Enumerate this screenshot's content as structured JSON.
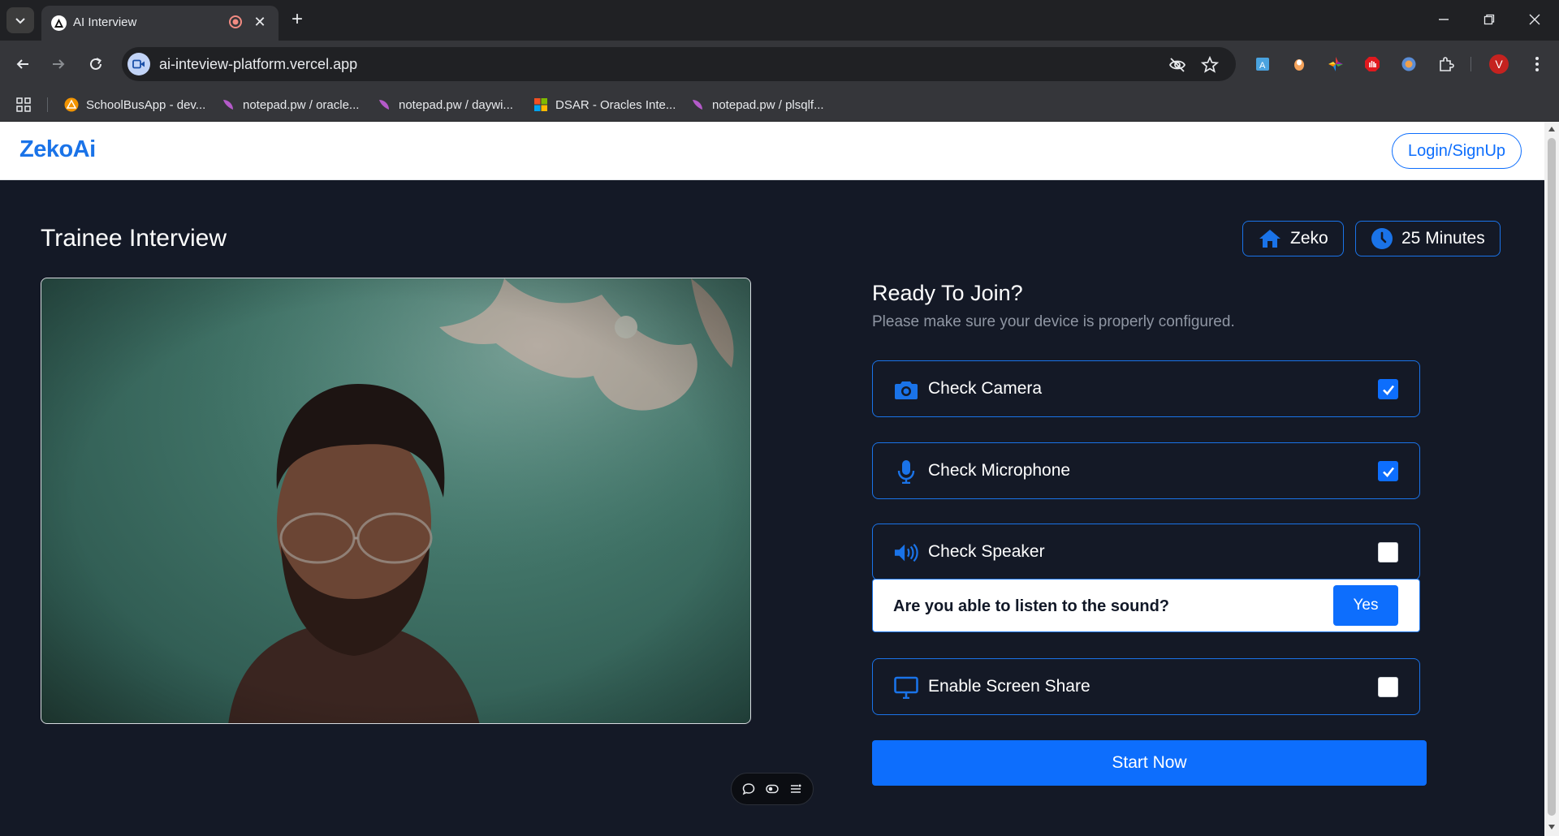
{
  "browser": {
    "tab_title": "AI Interview",
    "url": "ai-inteview-platform.vercel.app",
    "profile_initial": "V",
    "bookmarks": [
      {
        "label": "SchoolBusApp - dev..."
      },
      {
        "label": "notepad.pw / oracle..."
      },
      {
        "label": "notepad.pw / daywi..."
      },
      {
        "label": "DSAR - Oracles Inte..."
      },
      {
        "label": "notepad.pw / plsqlf..."
      }
    ]
  },
  "nav": {
    "brand": "ZekoAi",
    "login_label": "Login/SignUp"
  },
  "header": {
    "title": "Trainee Interview",
    "company_label": "Zeko",
    "duration_label": "25 Minutes"
  },
  "setup": {
    "title": "Ready To Join?",
    "subtitle": "Please make sure your device is properly configured.",
    "checks": [
      {
        "label": "Check Camera",
        "icon": "camera-icon",
        "checked": true
      },
      {
        "label": "Check Microphone",
        "icon": "microphone-icon",
        "checked": true
      },
      {
        "label": "Check Speaker",
        "icon": "speaker-icon",
        "checked": false
      },
      {
        "label": "Enable Screen Share",
        "icon": "monitor-icon",
        "checked": false
      }
    ],
    "sound_question": "Are you able to listen to the sound?",
    "yes_label": "Yes",
    "start_label": "Start Now"
  },
  "colors": {
    "accent": "#0d6efd",
    "page_bg": "#141926",
    "brand": "#1a73e8"
  }
}
